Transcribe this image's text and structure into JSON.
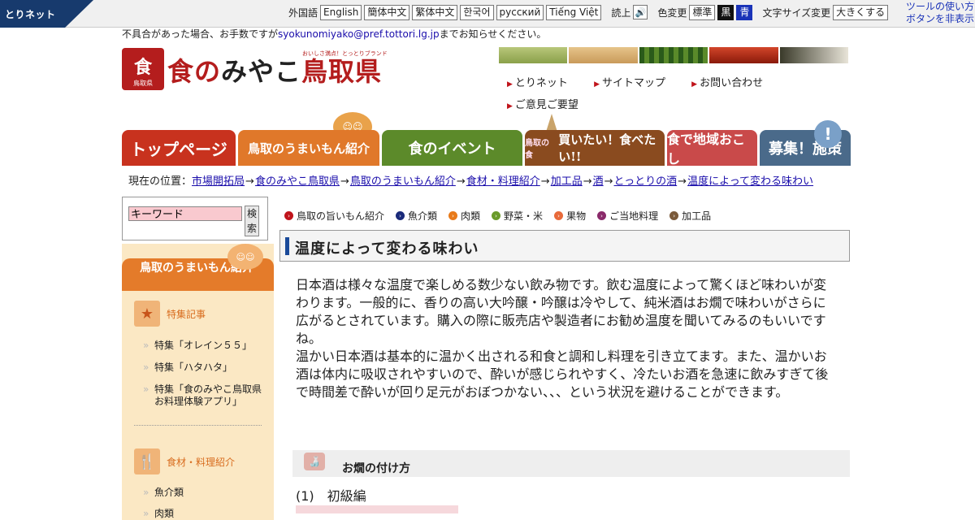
{
  "toolbar": {
    "brand": "とりネット",
    "foreign_lang_label": "外国語",
    "languages": [
      "English",
      "簡体中文",
      "繁体中文",
      "한국어",
      "русский",
      "Tiếng Việt"
    ],
    "readout_label": "読上",
    "color_change_label": "色変更",
    "color_options": [
      "標準",
      "黒",
      "青"
    ],
    "fontsize_label": "文字サイズ変更",
    "fontsize_button": "大きくする",
    "help_link": "ツールの使い方",
    "hide_link": "ボタンを非表示"
  },
  "notice": {
    "prefix": "不具合があった場合、お手数ですが",
    "email": "syokunomiyako@pref.tottori.lg.jp",
    "suffix": "までお知らせください。"
  },
  "logo": {
    "seal_big": "食",
    "seal_small": "鳥取県",
    "text_a": "食の",
    "text_b": "みやこ",
    "text_c": "鳥取県",
    "tagline": "おいしさ満点！とっとりブランド"
  },
  "header_links": [
    "とりネット",
    "サイトマップ",
    "お問い合わせ",
    "ご意見ご要望"
  ],
  "gnav": {
    "top": "トップページ",
    "umai": "鳥取のうまいもん紹介",
    "event": "食のイベント",
    "kaitai": "買いたい！食べたい!!",
    "kaitai_star": "鳥取の食",
    "chiiki": "食で地域おこし",
    "boshu": "募集！施策"
  },
  "breadcrumb": {
    "prefix": "現在の位置：",
    "items": [
      "市場開拓局",
      "食のみやこ鳥取県",
      "鳥取のうまいもん紹介",
      "食材・料理紹介",
      "加工品",
      "酒",
      "とっとりの酒",
      "温度によって変わる味わい"
    ]
  },
  "search": {
    "value": "キーワード",
    "button": "検索"
  },
  "sidebar": {
    "head": "鳥取のうまいもん紹介",
    "section1": "特集記事",
    "section1_links": [
      "特集「オレイン５５」",
      "特集「ハタハタ」",
      "特集「食のみやこ鳥取県お料理体験アプリ」"
    ],
    "section2": "食材・料理紹介",
    "section2_links": [
      "魚介類",
      "肉類"
    ]
  },
  "categories": [
    {
      "label": "鳥取の旨いもん紹介",
      "color": "#c0141b"
    },
    {
      "label": "魚介類",
      "color": "#1a2a7a"
    },
    {
      "label": "肉類",
      "color": "#e87a1a"
    },
    {
      "label": "野菜・米",
      "color": "#6a9a2a"
    },
    {
      "label": "果物",
      "color": "#e86a3a"
    },
    {
      "label": "ご当地料理",
      "color": "#8a2a6a"
    },
    {
      "label": "加工品",
      "color": "#7a5a3a"
    }
  ],
  "page_title": "温度によって変わる味わい",
  "body": {
    "p1": "日本酒は様々な温度で楽しめる数少ない飲み物です。飲む温度によって驚くほど味わいが変わります。一般的に、香りの高い大吟醸・吟醸は冷やして、純米酒はお燗で味わいがさらに広がるとされています。購入の際に販売店や製造者にお勧め温度を聞いてみるのもいいですね。",
    "p2": "温かい日本酒は基本的に温かく出される和食と調和し料理を引き立てます。また、温かいお酒は体内に吸収されやすいので、酔いが感じられやすく、冷たいお酒を急速に飲みすぎて後で時間差で酔いが回り足元がおぼつかない、、、という状況を避けることができます。"
  },
  "sub_head": "お燗の付け方",
  "level": "(1)　初級編"
}
